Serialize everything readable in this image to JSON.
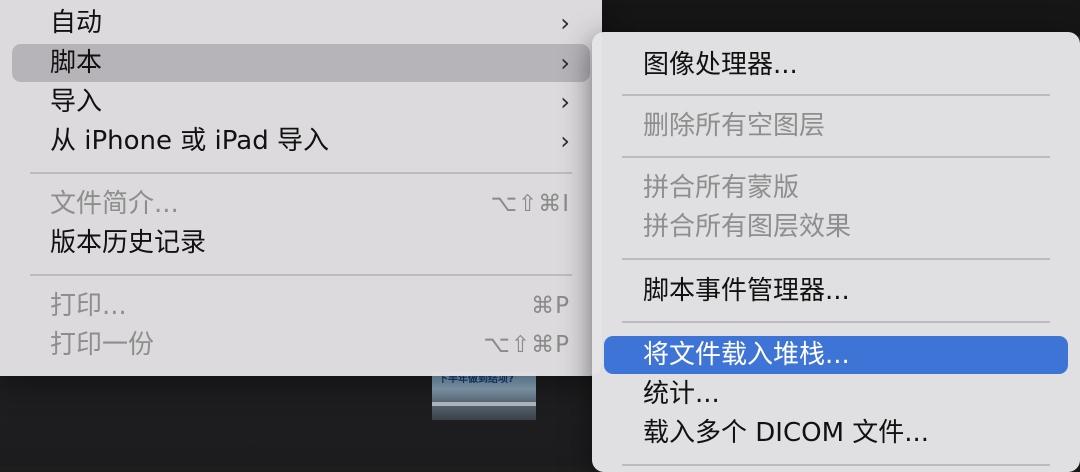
{
  "main_menu": {
    "items": [
      {
        "label": "自动",
        "chevron": "›"
      },
      {
        "label": "脚本",
        "chevron": "›"
      },
      {
        "label": "导入",
        "chevron": "›"
      },
      {
        "label": "从 iPhone 或 iPad 导入",
        "chevron": "›"
      },
      {
        "label": "文件简介...",
        "shortcut": "⌥⇧⌘I"
      },
      {
        "label": "版本历史记录"
      },
      {
        "label": "打印...",
        "shortcut": "⌘P"
      },
      {
        "label": "打印一份",
        "shortcut": "⌥⇧⌘P"
      }
    ]
  },
  "scripts_submenu": {
    "items": [
      {
        "label": "图像处理器..."
      },
      {
        "label": "删除所有空图层"
      },
      {
        "label": "拼合所有蒙版"
      },
      {
        "label": "拼合所有图层效果"
      },
      {
        "label": "脚本事件管理器..."
      },
      {
        "label": "将文件载入堆栈..."
      },
      {
        "label": "统计..."
      },
      {
        "label": "载入多个 DICOM 文件..."
      }
    ]
  },
  "background": {
    "thumbnail_caption": "下半年做到结项?"
  },
  "colors": {
    "menu_bg": "#e2e0e2",
    "selected": "#3e74d6",
    "hover": "#b4b2b6",
    "disabled_text": "#8e8e8e"
  }
}
